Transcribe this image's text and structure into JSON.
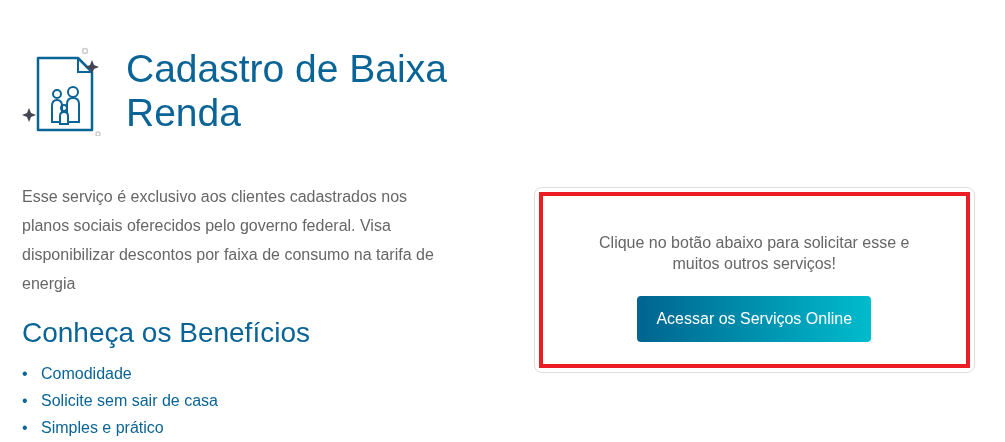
{
  "title": "Cadastro de Baixa Renda",
  "description": "Esse serviço é exclusivo aos clientes cadastrados nos planos sociais oferecidos pelo governo federal. Visa disponibilizar descontos por faixa de consumo na tarifa de energia",
  "benefits": {
    "heading": "Conheça os Benefícios",
    "items": [
      {
        "marker": "•",
        "label": "Comodidade"
      },
      {
        "marker": "•",
        "label": "Solicite sem sair de casa"
      },
      {
        "marker": "•",
        "label": "Simples e prático"
      }
    ]
  },
  "cta": {
    "text": "Clique no botão abaixo para solicitar esse e muitos outros serviços!",
    "button": "Acessar os Serviços Online",
    "highlighted": true
  }
}
